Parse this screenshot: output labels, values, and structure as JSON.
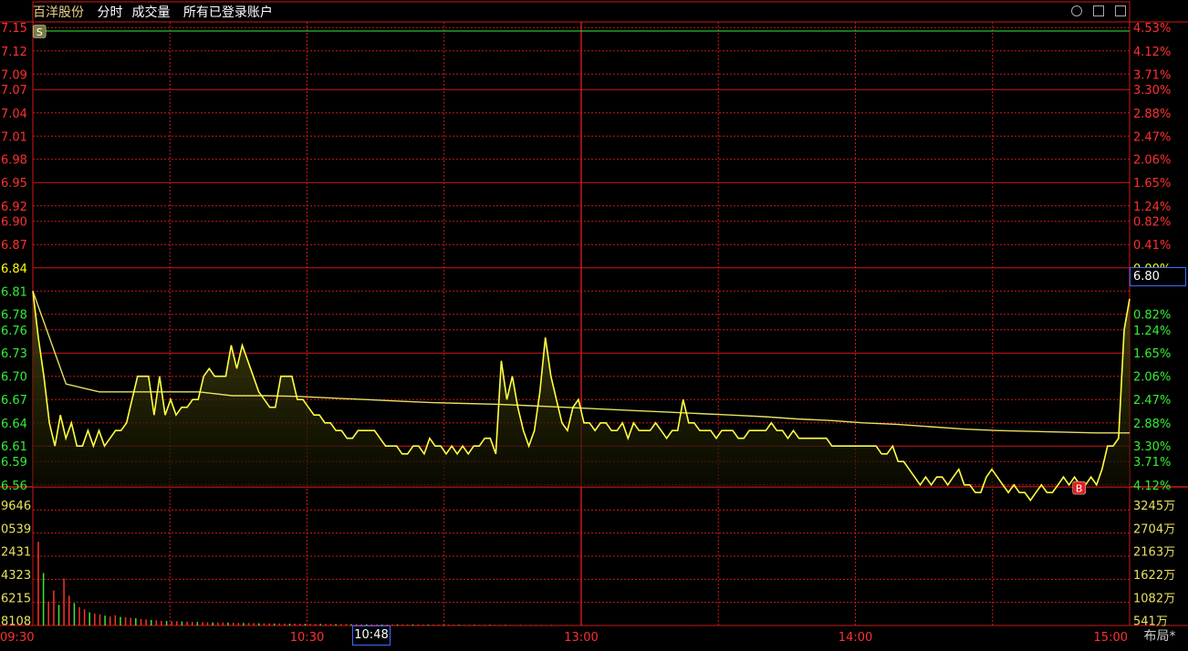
{
  "header": {
    "stock_name": "百洋股份",
    "mode": "分时",
    "indicator": "成交量",
    "account": "所有已登录账户"
  },
  "footer": {
    "layout_label": "布局*",
    "cursor_time": "10:48"
  },
  "price_cursor": "6.80",
  "colors": {
    "up": "#ff3030",
    "down": "#33ee33",
    "flat": "#ffff00",
    "price_line": "#ffff40",
    "avg_line": "#e8e060",
    "grid": "#d01818",
    "area_top": "#4a4a10",
    "cursor_border": "#3a6cff",
    "marker_bg": "#e02020"
  },
  "chart_data": {
    "type": "line",
    "title": "",
    "prev_close": 6.84,
    "price_axis": {
      "labels": [
        "7.15",
        "7.12",
        "7.09",
        "7.07",
        "7.04",
        "7.01",
        "6.98",
        "6.95",
        "6.92",
        "6.90",
        "6.87",
        "6.84",
        "6.81",
        "6.78",
        "6.76",
        "6.73",
        "6.70",
        "6.67",
        "6.64",
        "6.61",
        "6.59",
        "6.56"
      ],
      "range": [
        6.555,
        7.155
      ]
    },
    "pct_axis": {
      "labels": [
        "4.53%",
        "4.12%",
        "3.71%",
        "3.30%",
        "2.88%",
        "2.47%",
        "2.06%",
        "1.65%",
        "1.24%",
        "0.82%",
        "0.41%",
        "0.00%",
        "0.82%",
        "1.24%",
        "1.65%",
        "2.06%",
        "2.47%",
        "2.88%",
        "3.30%",
        "3.71%",
        "4.12%"
      ]
    },
    "time_axis": {
      "labels": [
        "09:30",
        "10:30",
        "13:00",
        "14:00",
        "15:00"
      ]
    },
    "volume_axis": {
      "left_labels": [
        "9646",
        "0539",
        "2431",
        "4323",
        "6215",
        "8108"
      ],
      "right_labels": [
        "3245万",
        "2704万",
        "2163万",
        "1622万",
        "1082万",
        "541万"
      ],
      "max_wan": 3245
    },
    "series": [
      {
        "type": "price",
        "values": [
          6.81,
          6.75,
          6.7,
          6.64,
          6.61,
          6.65,
          6.62,
          6.64,
          6.61,
          6.61,
          6.63,
          6.61,
          6.63,
          6.61,
          6.62,
          6.63,
          6.63,
          6.64,
          6.67,
          6.7,
          6.7,
          6.7,
          6.65,
          6.7,
          6.65,
          6.67,
          6.65,
          6.66,
          6.66,
          6.67,
          6.67,
          6.7,
          6.71,
          6.7,
          6.7,
          6.7,
          6.74,
          6.71,
          6.74,
          6.72,
          6.7,
          6.68,
          6.67,
          6.66,
          6.66,
          6.7,
          6.7,
          6.7,
          6.67,
          6.67,
          6.66,
          6.65,
          6.65,
          6.64,
          6.64,
          6.63,
          6.63,
          6.62,
          6.62,
          6.63,
          6.63,
          6.63,
          6.63,
          6.62,
          6.61,
          6.61,
          6.61,
          6.6,
          6.6,
          6.61,
          6.61,
          6.6,
          6.62,
          6.61,
          6.61,
          6.6,
          6.61,
          6.6,
          6.61,
          6.6,
          6.61,
          6.61,
          6.62,
          6.62,
          6.6,
          6.72,
          6.67,
          6.7,
          6.66,
          6.63,
          6.61,
          6.63,
          6.68,
          6.75,
          6.7,
          6.67,
          6.64,
          6.63,
          6.66,
          6.67,
          6.64,
          6.64,
          6.63,
          6.64,
          6.64,
          6.63,
          6.63,
          6.64,
          6.62,
          6.64,
          6.63,
          6.63,
          6.63,
          6.64,
          6.63,
          6.62,
          6.63,
          6.63,
          6.67,
          6.64,
          6.64,
          6.63,
          6.63,
          6.63,
          6.62,
          6.63,
          6.63,
          6.63,
          6.62,
          6.62,
          6.63,
          6.63,
          6.63,
          6.63,
          6.64,
          6.63,
          6.63,
          6.62,
          6.63,
          6.62,
          6.62,
          6.62,
          6.62,
          6.62,
          6.62,
          6.61,
          6.61,
          6.61,
          6.61,
          6.61,
          6.61,
          6.61,
          6.61,
          6.61,
          6.6,
          6.6,
          6.61,
          6.59,
          6.59,
          6.58,
          6.57,
          6.56,
          6.57,
          6.56,
          6.57,
          6.57,
          6.56,
          6.57,
          6.58,
          6.56,
          6.56,
          6.55,
          6.55,
          6.57,
          6.58,
          6.57,
          6.56,
          6.55,
          6.56,
          6.55,
          6.55,
          6.54,
          6.55,
          6.56,
          6.55,
          6.55,
          6.56,
          6.57,
          6.56,
          6.57,
          6.56,
          6.56,
          6.57,
          6.56,
          6.58,
          6.61,
          6.61,
          6.62,
          6.76,
          6.8
        ]
      },
      {
        "type": "avg",
        "values": [
          6.81,
          6.69,
          6.68,
          6.68,
          6.68,
          6.68,
          6.675,
          6.675,
          6.674,
          6.672,
          6.67,
          6.668,
          6.666,
          6.665,
          6.664,
          6.662,
          6.66,
          6.658,
          6.656,
          6.654,
          6.652,
          6.65,
          6.648,
          6.645,
          6.643,
          6.64,
          6.638,
          6.635,
          6.632,
          6.63,
          6.629,
          6.628,
          6.627,
          6.627
        ]
      }
    ],
    "markers": [
      {
        "label": "S",
        "x_fraction": 0.006,
        "price": 7.145
      },
      {
        "label": "B",
        "x_fraction": 0.954,
        "price": 6.556
      }
    ],
    "volume": {
      "unit": "万",
      "values_wan": [
        1960,
        1230,
        560,
        820,
        480,
        1100,
        700,
        520,
        430,
        380,
        310,
        280,
        260,
        230,
        210,
        240,
        200,
        190,
        180,
        170,
        150,
        140,
        130,
        120,
        110,
        105,
        100,
        98,
        95,
        90,
        86,
        82,
        78,
        75,
        72,
        70,
        68,
        66,
        64,
        62,
        60,
        58,
        56,
        54,
        52,
        50,
        48,
        46,
        44,
        42,
        41,
        40,
        39,
        38,
        37,
        36,
        35,
        34,
        33,
        32,
        31,
        30,
        29,
        28,
        27,
        26,
        25,
        24,
        24,
        23,
        23,
        22,
        22,
        21,
        21,
        20,
        20,
        19,
        19,
        18,
        18,
        17,
        17,
        16,
        16,
        15,
        15,
        14,
        14,
        13,
        13,
        12,
        12,
        11,
        11,
        10,
        10,
        9,
        9,
        8,
        8,
        7,
        7,
        6,
        6,
        5,
        5,
        4,
        4,
        3,
        3,
        2,
        2,
        2,
        2,
        2,
        2,
        2,
        2,
        2,
        2,
        2,
        2,
        2,
        2,
        2,
        2,
        2,
        2,
        2,
        2,
        2,
        2,
        2,
        2,
        2,
        2,
        2,
        2,
        2,
        2,
        2,
        2,
        2,
        2,
        2,
        2,
        2,
        2,
        2,
        2,
        2,
        2,
        2,
        2,
        2,
        2,
        2,
        2,
        2,
        2,
        2,
        2,
        2,
        2,
        2,
        2,
        2,
        2,
        2,
        2,
        2,
        2,
        2,
        2,
        2,
        2,
        2,
        2,
        2,
        2,
        2,
        2,
        2,
        2,
        2,
        2,
        2,
        2,
        2,
        2,
        2,
        2,
        2,
        2,
        2,
        2,
        2,
        2,
        2,
        2,
        2,
        2,
        2,
        2,
        2,
        2,
        2,
        2,
        2,
        2,
        2,
        2
      ]
    }
  }
}
